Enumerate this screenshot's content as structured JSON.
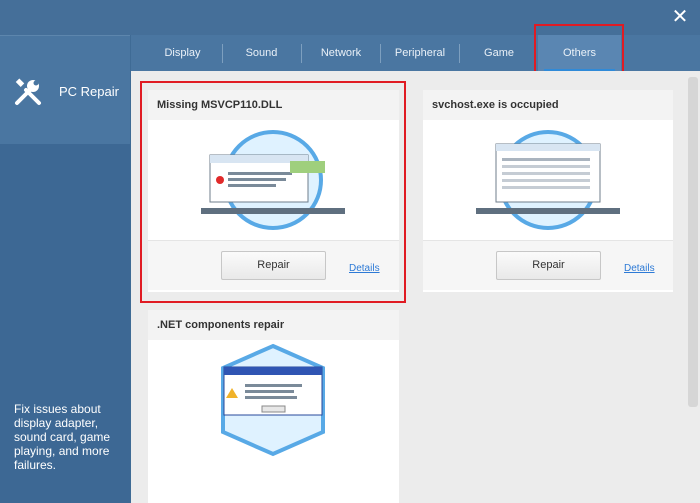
{
  "app": {
    "title": "PC Repair",
    "description": "Fix issues about display adapter, sound card, game playing, and more failures."
  },
  "tabs": [
    {
      "label": "Display"
    },
    {
      "label": "Sound"
    },
    {
      "label": "Network"
    },
    {
      "label": "Peripheral"
    },
    {
      "label": "Game"
    },
    {
      "label": "Others",
      "active": true
    }
  ],
  "cards": [
    {
      "title": "Missing MSVCP110.DLL",
      "button": "Repair",
      "link": "Details",
      "image_dialog": "The program can't start because MSVCP110.dll is missing from your computer. Try reinstalling the program to fix this problem."
    },
    {
      "title": "svchost.exe is occupied",
      "button": "Repair",
      "link": "Details"
    },
    {
      "title": ".NET components repair",
      "image_dialog": "The application requires .NET Framework 1.0.3705 or .NET Framework 4.0. Please install .NET Framework first."
    }
  ],
  "colors": {
    "highlight": "#e01b23",
    "link": "#2d7ad6"
  },
  "icons": {
    "close": "close-icon",
    "tools": "wrench-screwdriver-icon"
  }
}
